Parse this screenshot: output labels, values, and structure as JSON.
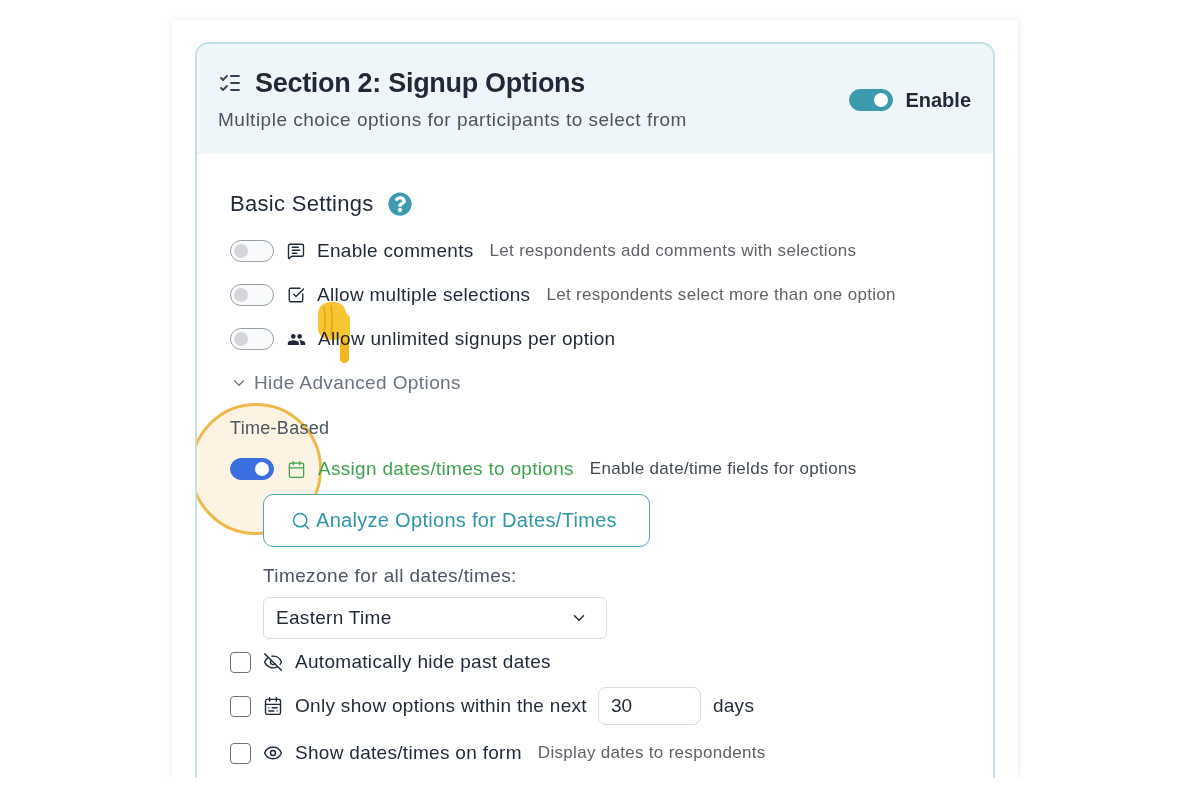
{
  "section": {
    "title": "Section 2: Signup Options",
    "subtitle": "Multiple choice options for participants to select from",
    "enable": {
      "label": "Enable",
      "on": true
    }
  },
  "basic_settings": {
    "title": "Basic Settings",
    "settings": [
      {
        "label": "Enable comments",
        "description": "Let respondents add comments with selections",
        "on": false
      },
      {
        "label": "Allow multiple selections",
        "description": "Let respondents select more than one option",
        "on": false
      },
      {
        "label": "Allow unlimited signups per option",
        "on": false
      }
    ]
  },
  "advanced_toggle": {
    "label": "Hide Advanced Options",
    "expanded": true
  },
  "time_based": {
    "title": "Time-Based",
    "assign": {
      "label": "Assign dates/times to options",
      "description": "Enable date/time fields for options",
      "on": true
    },
    "analyze_button": "Analyze Options for Dates/Times",
    "timezone": {
      "label": "Timezone for all dates/times:",
      "value": "Eastern Time"
    },
    "options": [
      {
        "kind": "check",
        "label": "Automatically hide past dates",
        "checked": false
      },
      {
        "kind": "range",
        "label": "Only show options within the next",
        "value": "30",
        "unit": "days",
        "checked": false
      },
      {
        "kind": "check",
        "label": "Show dates/times on form",
        "description": "Display dates to respondents",
        "checked": false
      }
    ]
  }
}
